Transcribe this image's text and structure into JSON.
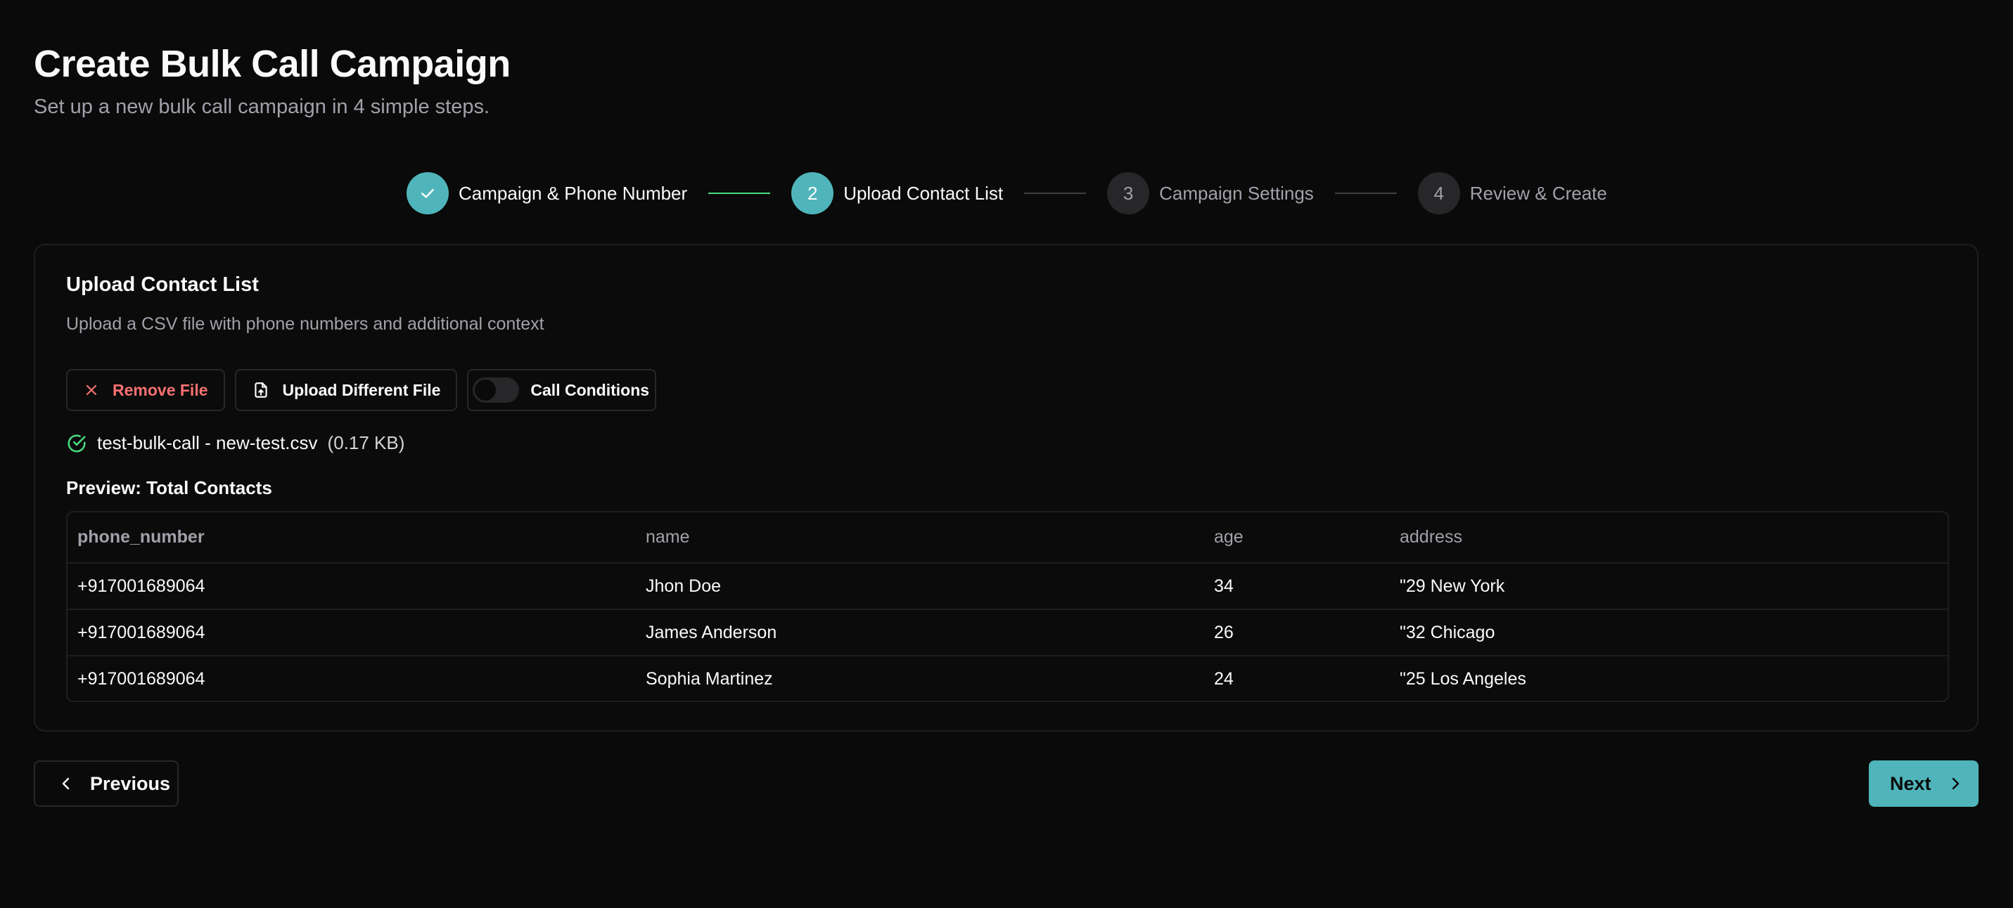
{
  "header": {
    "title": "Create Bulk Call Campaign",
    "subtitle": "Set up a new bulk call campaign in 4 simple steps."
  },
  "stepper": {
    "steps": [
      {
        "number": "1",
        "label": "Campaign & Phone Number",
        "status": "completed"
      },
      {
        "number": "2",
        "label": "Upload Contact List",
        "status": "active"
      },
      {
        "number": "3",
        "label": "Campaign Settings",
        "status": "pending"
      },
      {
        "number": "4",
        "label": "Review & Create",
        "status": "pending"
      }
    ]
  },
  "upload": {
    "title": "Upload Contact List",
    "description": "Upload a CSV file with phone numbers and additional context",
    "remove_label": "Remove File",
    "upload_different_label": "Upload Different File",
    "call_conditions_label": "Call Conditions",
    "call_conditions_enabled": false,
    "file_name": "test-bulk-call - new-test.csv",
    "file_size": "(0.17 KB)",
    "preview_label": "Preview: Total Contacts"
  },
  "table": {
    "columns": [
      "phone_number",
      "name",
      "age",
      "address"
    ],
    "rows": [
      [
        "+917001689064",
        "Jhon Doe",
        "34",
        "\"29 New York"
      ],
      [
        "+917001689064",
        "James Anderson",
        "26",
        "\"32 Chicago"
      ],
      [
        "+917001689064",
        "Sophia Martinez",
        "24",
        "\"25 Los Angeles"
      ]
    ]
  },
  "footer": {
    "previous_label": "Previous",
    "next_label": "Next"
  },
  "colors": {
    "accent": "#4fb5ba",
    "success": "#4ade80",
    "danger": "#f87171",
    "background": "#0a0a0a"
  },
  "icons": {
    "step_done": "check-icon",
    "remove": "close-icon",
    "upload": "file-upload-icon",
    "file_status": "check-circle-icon",
    "previous": "chevron-left-icon",
    "next": "chevron-right-icon"
  }
}
